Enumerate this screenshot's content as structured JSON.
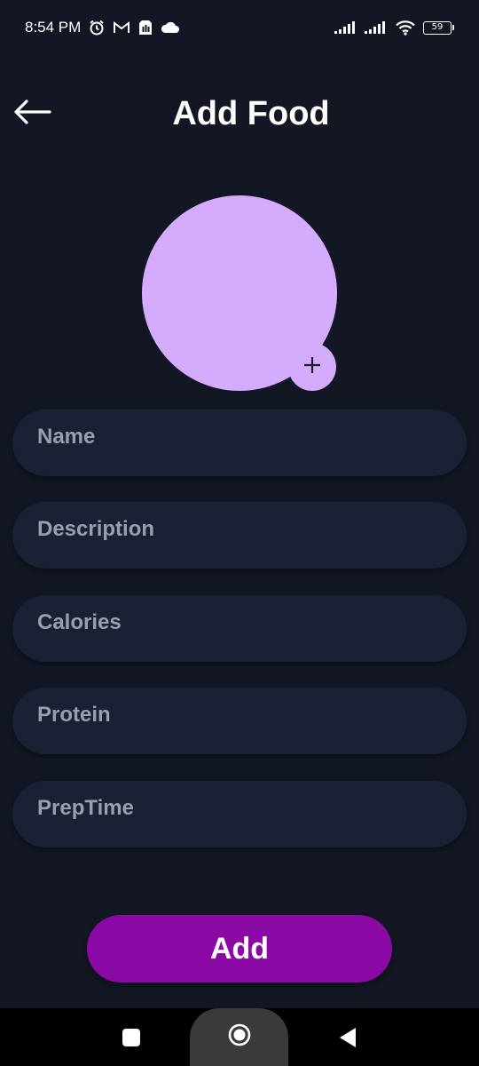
{
  "status_bar": {
    "time": "8:54 PM",
    "left_icons": [
      "alarm-icon",
      "gmail-icon",
      "sim-icon",
      "cloud-icon"
    ],
    "right_icons": [
      "signal-icon",
      "signal-icon",
      "wifi-icon",
      "battery-icon"
    ],
    "battery_level": "59"
  },
  "header": {
    "title": "Add Food",
    "back_icon": "arrow-left-icon"
  },
  "image_picker": {
    "color": "#d5acfd",
    "add_icon": "plus-icon"
  },
  "form": {
    "fields": [
      {
        "placeholder": "Name",
        "value": ""
      },
      {
        "placeholder": "Description",
        "value": ""
      },
      {
        "placeholder": "Calories",
        "value": ""
      },
      {
        "placeholder": "Protein",
        "value": ""
      },
      {
        "placeholder": "PrepTime",
        "value": ""
      }
    ],
    "submit_label": "Add"
  },
  "nav_bar": {
    "icons": [
      "recents-icon",
      "home-icon",
      "back-icon"
    ]
  },
  "colors": {
    "background": "#121723",
    "field_bg": "#1b2135",
    "accent": "#8b0aa5",
    "avatar": "#d5acfd",
    "placeholder": "#9aa0ab"
  }
}
